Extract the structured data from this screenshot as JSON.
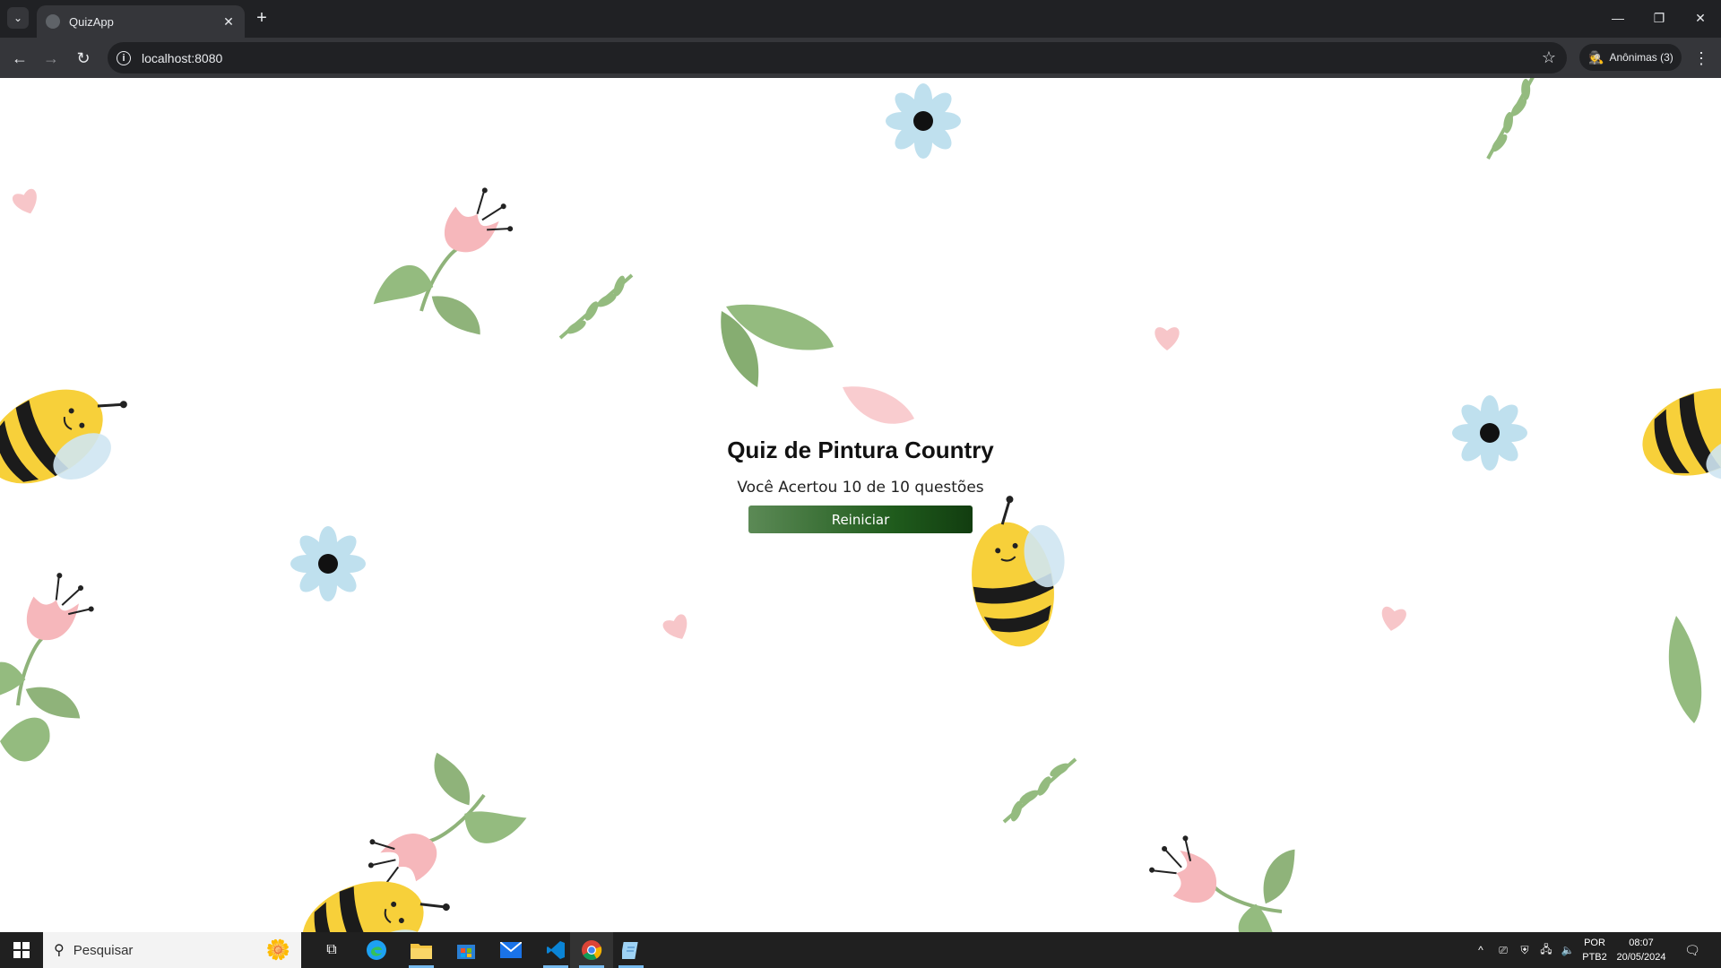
{
  "browser": {
    "tab_title": "QuizApp",
    "url": "localhost:8080",
    "incognito_label": "Anônimas (3)"
  },
  "page": {
    "quiz_title": "Quiz de Pintura Country",
    "result_text": "Você Acertou 10 de 10 questões",
    "restart_label": "Reiniciar"
  },
  "taskbar": {
    "search_placeholder": "Pesquisar",
    "language_top": "POR",
    "language_bottom": "PTB2",
    "time": "08:07",
    "date": "20/05/2024"
  },
  "icons": {
    "tab_list": "chevron-down-icon",
    "close_tab": "close-icon",
    "new_tab": "plus-icon",
    "back": "arrow-left-icon",
    "forward": "arrow-right-icon",
    "reload": "reload-icon",
    "site_info": "info-icon",
    "bookmark": "star-icon",
    "incognito": "incognito-icon",
    "menu": "kebab-menu-icon"
  },
  "colors": {
    "button_start": "#5c8a56",
    "button_end": "#123d10",
    "chrome_dark": "#202124",
    "chrome_toolbar": "#35363a"
  }
}
